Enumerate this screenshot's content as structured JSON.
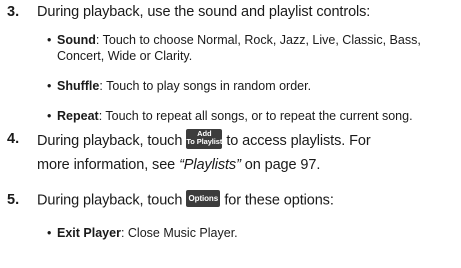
{
  "step3": {
    "number": "3.",
    "text": "During playback, use the sound and playlist controls:",
    "bullets": [
      {
        "term": "Sound",
        "desc": ": Touch to choose Normal, Rock, Jazz, Live, Classic, Bass, Concert, Wide or Clarity."
      },
      {
        "term": "Shuffle",
        "desc": ": Touch to play songs in random order."
      },
      {
        "term": "Repeat",
        "desc": ": Touch to repeat all songs, or to repeat the current song."
      }
    ]
  },
  "step4": {
    "number": "4.",
    "before": "During playback, touch",
    "button_line1": "Add",
    "button_line2": "To Playlist",
    "after": "to access playlists. For",
    "line2_before": "more information, see",
    "ref": "“Playlists”",
    "line2_after": "on page 97."
  },
  "step5": {
    "number": "5.",
    "before": "During playback, touch",
    "button": "Options",
    "after": "for these options:",
    "bullets": [
      {
        "term": "Exit Player",
        "desc": ": Close Music Player."
      }
    ]
  }
}
